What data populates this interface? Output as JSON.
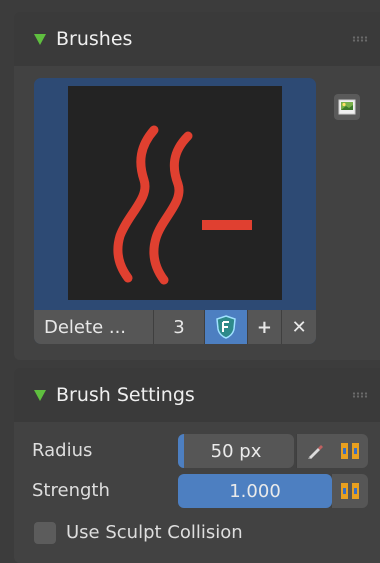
{
  "brushes_panel": {
    "title": "Brushes",
    "brush_name": "Delete ...",
    "user_count": "3",
    "fake_user_icon": "shield-f-icon",
    "add_icon": "plus-icon",
    "delete_icon": "x-icon",
    "side_icon": "image-browse-icon"
  },
  "settings_panel": {
    "title": "Brush Settings",
    "radius_label": "Radius",
    "radius_value": "50 px",
    "strength_label": "Strength",
    "strength_value": "1.000",
    "collision_label": "Use Sculpt Collision"
  },
  "colors": {
    "accent": "#4d7fc1",
    "panel_header": "#3a3a3a",
    "brush_icon": "#e04030",
    "triangle": "#5fbf3f"
  }
}
